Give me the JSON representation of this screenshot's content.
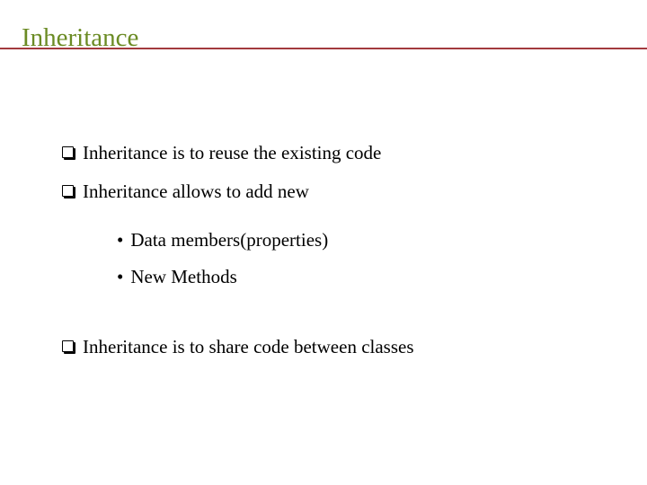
{
  "slide": {
    "title": "Inheritance",
    "colors": {
      "title": "#6b8b24",
      "rule": "#a23a3e"
    },
    "bullets": [
      {
        "level": 1,
        "marker": "checkbox",
        "text": "Inheritance is to reuse the existing code"
      },
      {
        "level": 1,
        "marker": "checkbox",
        "text": "Inheritance allows to add new"
      },
      {
        "level": 2,
        "marker": "•",
        "text": "Data members(properties)"
      },
      {
        "level": 2,
        "marker": "•",
        "text": "New Methods"
      },
      {
        "level": 1,
        "marker": "checkbox",
        "text": "Inheritance is to share code between classes"
      }
    ]
  }
}
